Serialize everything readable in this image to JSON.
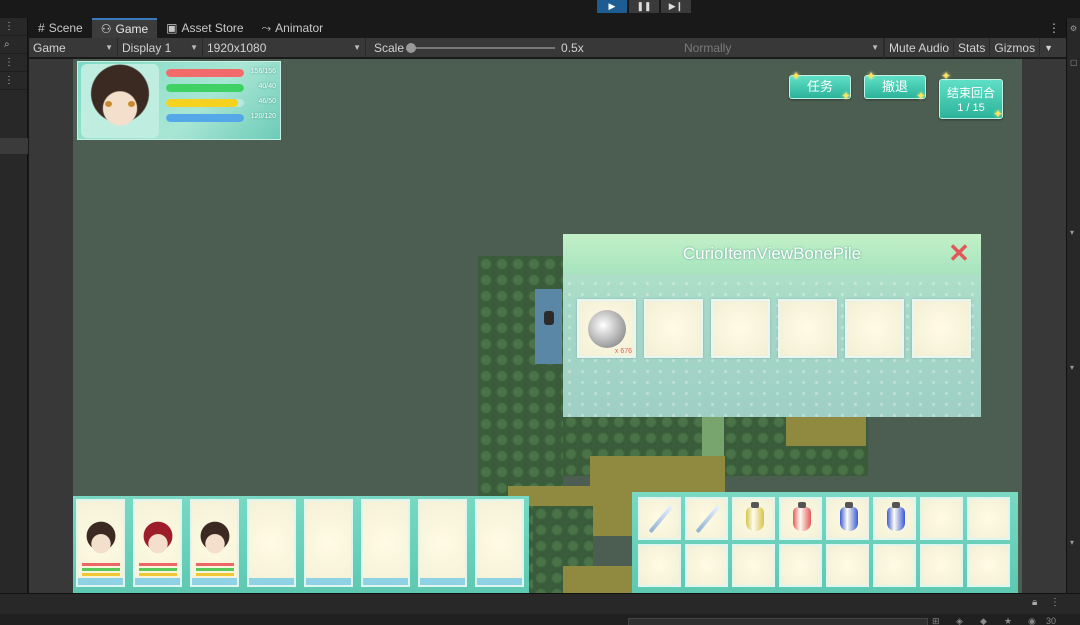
{
  "editor": {
    "tabs": [
      {
        "label": "Scene",
        "icon": "grid-icon"
      },
      {
        "label": "Game",
        "icon": "gamepad-icon"
      },
      {
        "label": "Asset Store",
        "icon": "bag-icon"
      },
      {
        "label": "Animator",
        "icon": "animator-icon"
      }
    ],
    "toolbar": {
      "view_mode": "Game",
      "display": "Display 1",
      "resolution": "1920x1080",
      "scale_label": "Scale",
      "scale_value": "0.5x",
      "play_mode": "Normally",
      "mute_audio": "Mute Audio",
      "stats": "Stats",
      "gizmos": "Gizmos"
    },
    "bottom": {
      "search_value": "",
      "badge": "30"
    }
  },
  "game": {
    "player": {
      "hp": "156/156",
      "mp": "40/40",
      "sp": "46/50",
      "exp": "120/120",
      "bars": [
        {
          "fraction": 1.0,
          "color": "#f26b6b"
        },
        {
          "fraction": 1.0,
          "color": "#3fd163"
        },
        {
          "fraction": 0.92,
          "color": "#f5d21f"
        },
        {
          "fraction": 1.0,
          "color": "#55a8e8"
        }
      ]
    },
    "buttons": {
      "quest": "任务",
      "undo": "撤退",
      "end_turn": "结束回合",
      "turn_counter": "1 / 15"
    },
    "curio_popup": {
      "title": "CurioItemViewBonePile",
      "close": "✕",
      "slots": [
        {
          "has_item": true,
          "count": "x 676"
        },
        {
          "has_item": false,
          "count": ""
        },
        {
          "has_item": false,
          "count": ""
        },
        {
          "has_item": false,
          "count": ""
        },
        {
          "has_item": false,
          "count": ""
        },
        {
          "has_item": false,
          "count": ""
        }
      ]
    },
    "party": [
      {
        "filled": true,
        "face": "#3b2a22"
      },
      {
        "filled": true,
        "face": "#9e1d2a"
      },
      {
        "filled": true,
        "face": "#3b2a22"
      },
      {
        "filled": false
      },
      {
        "filled": false
      },
      {
        "filled": false
      },
      {
        "filled": false
      },
      {
        "filled": false
      }
    ],
    "inventory": [
      {
        "type": "sword"
      },
      {
        "type": "sword"
      },
      {
        "type": "pot",
        "color": "#d6c44a"
      },
      {
        "type": "pot",
        "color": "#e45a5a"
      },
      {
        "type": "pot",
        "color": "#3b5bd6"
      },
      {
        "type": "pot",
        "color": "#3b5bd6"
      },
      {
        "type": "empty"
      },
      {
        "type": "empty"
      },
      {
        "type": "empty"
      },
      {
        "type": "empty"
      },
      {
        "type": "empty"
      },
      {
        "type": "empty"
      },
      {
        "type": "empty"
      },
      {
        "type": "empty"
      },
      {
        "type": "empty"
      },
      {
        "type": "empty"
      }
    ]
  }
}
